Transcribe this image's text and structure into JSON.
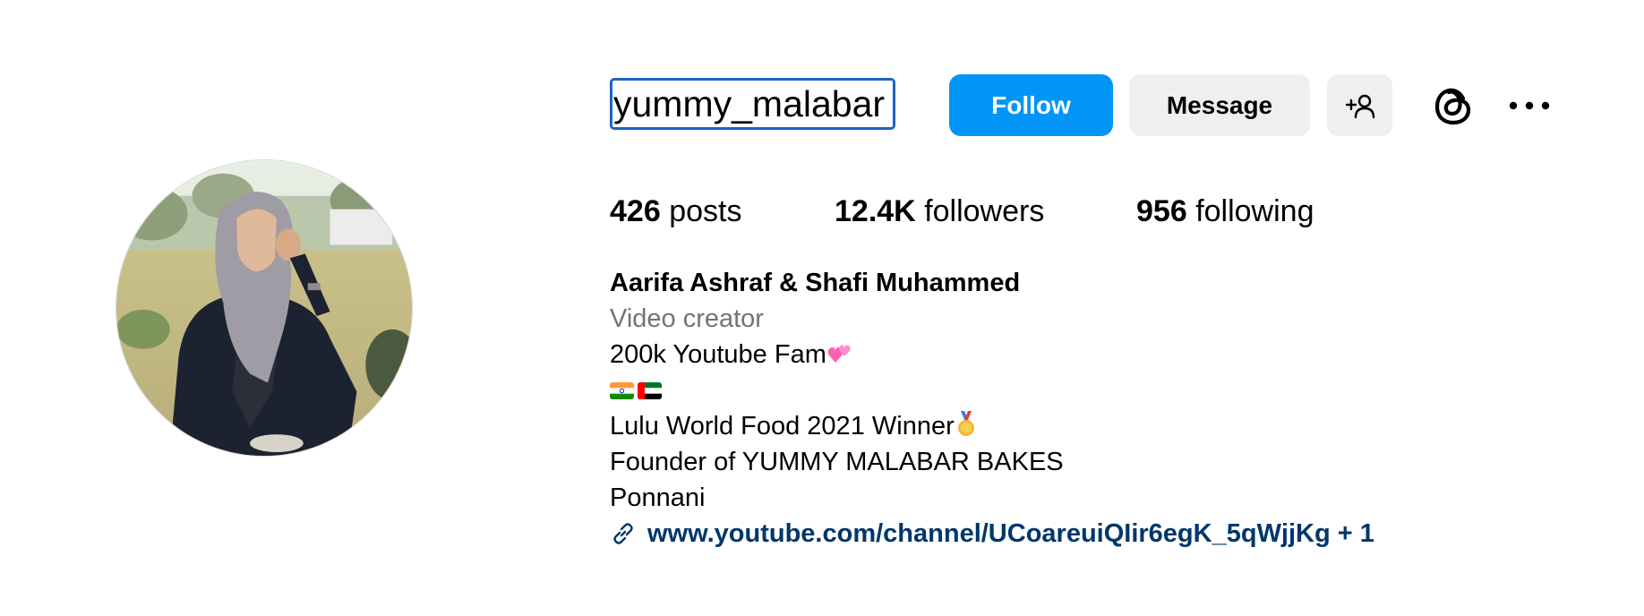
{
  "profile": {
    "username": "yummy_malabar",
    "follow_label": "Follow",
    "message_label": "Message",
    "suggest_icon": "add-person-icon",
    "threads_icon": "threads-icon",
    "more_icon": "more-options-icon"
  },
  "stats": {
    "posts_count": "426",
    "posts_label": "posts",
    "followers_count": "12.4K",
    "followers_label": "followers",
    "following_count": "956",
    "following_label": "following"
  },
  "bio": {
    "full_name": "Aarifa Ashraf & Shafi Muhammed",
    "category": "Video creator",
    "line1": "200k Youtube Fam",
    "line1_emoji": "pink-hearts-icon",
    "flags": [
      "india-flag-icon",
      "uae-flag-icon"
    ],
    "line2": "Lulu World Food 2021 Winner",
    "line2_emoji": "medal-icon",
    "line3": "Founder of YUMMY MALABAR BAKES",
    "line4": "Ponnani",
    "link_text": "www.youtube.com/channel/UCoareuiQIir6egK_5qWjjKg + 1",
    "link_icon": "link-icon"
  },
  "colors": {
    "follow_button": "#0095f6",
    "secondary_button": "#efefef",
    "link": "#00376b",
    "muted_text": "#737373",
    "focus_outline": "#1f63c4"
  }
}
